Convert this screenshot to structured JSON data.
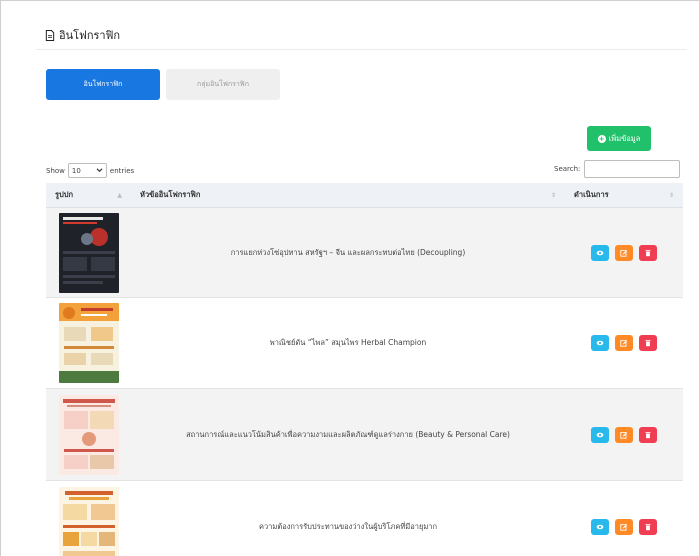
{
  "header": {
    "title": "อินโฟกราฟิก",
    "icon": "document-icon"
  },
  "tabs": [
    {
      "label": "อินโฟกราฟิก",
      "active": true
    },
    {
      "label": "กลุ่มอินโฟกราฟิก",
      "active": false
    }
  ],
  "toolbar": {
    "add_label": "เพิ่มข้อมูล"
  },
  "length": {
    "show": "Show",
    "value": "10",
    "entries": "entries"
  },
  "search": {
    "label": "Search:",
    "value": ""
  },
  "table": {
    "columns": [
      "รูปปก",
      "หัวข้ออินโฟกราฟิก",
      "ดำเนินการ"
    ],
    "rows": [
      {
        "title": "การแยกห่วงโซ่อุปทาน สหรัฐฯ – จีน และผลกระทบต่อไทย (Decoupling)"
      },
      {
        "title": "พาณิชย์ดัน “ไพล” สมุนไพร Herbal Champion"
      },
      {
        "title": "สถานการณ์และแนวโน้มสินค้าเพื่อความงามและผลิตภัณฑ์ดูแลร่างกาย (Beauty & Personal Care)"
      },
      {
        "title": "ความต้องการรับประทานของว่างในผู้บริโภคที่มีอายุมาก"
      }
    ]
  },
  "colors": {
    "primary": "#1877e0",
    "success": "#21c16b",
    "info": "#27b8ec",
    "warning": "#ff8a26",
    "danger": "#ef3d52"
  }
}
